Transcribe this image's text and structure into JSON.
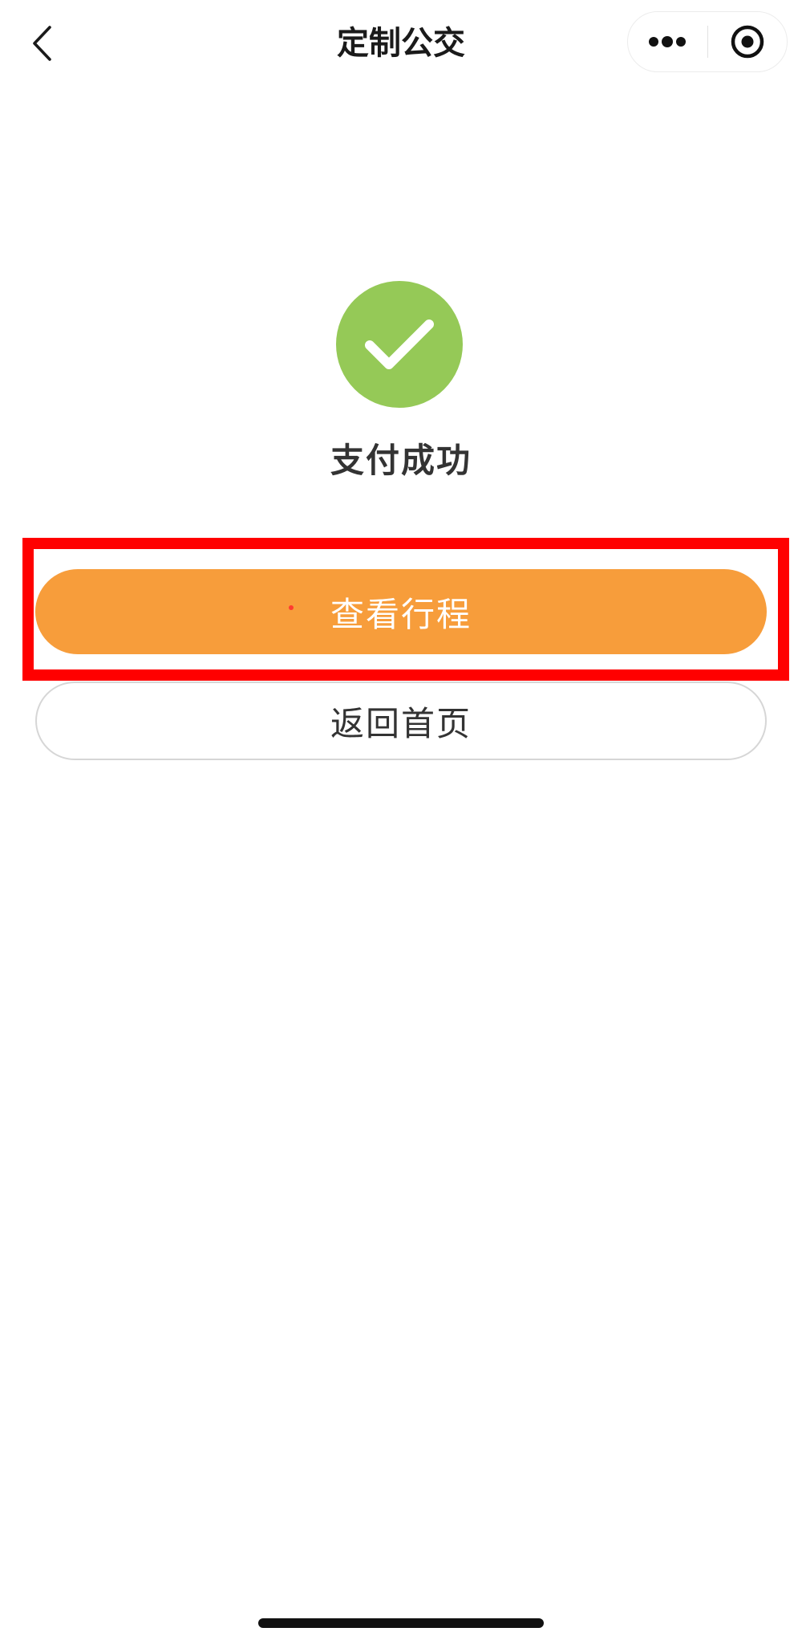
{
  "nav": {
    "title": "定制公交",
    "back_icon": "chevron-left-icon",
    "more_icon": "more-dots-icon",
    "close_icon": "target-circle-icon"
  },
  "result": {
    "status_icon": "checkmark-icon",
    "status_text": "支付成功",
    "status_color": "#95c957"
  },
  "actions": {
    "view_trip_label": "查看行程",
    "view_trip_color": "#f79d3b",
    "home_label": "返回首页"
  },
  "annotation": {
    "highlight_color": "#ff0000"
  }
}
